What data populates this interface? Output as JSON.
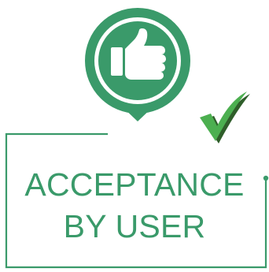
{
  "caption": {
    "line1": "ACCEPTANCE",
    "line2": "BY USER"
  },
  "icons": {
    "pin": "map-pin-icon",
    "thumb": "thumbs-up-icon",
    "check": "checkmark-icon"
  },
  "colors": {
    "primary_green": "#3a9a6a",
    "check_green": "#4caf50",
    "check_dark": "#2f5e2a",
    "background": "#ffffff"
  }
}
